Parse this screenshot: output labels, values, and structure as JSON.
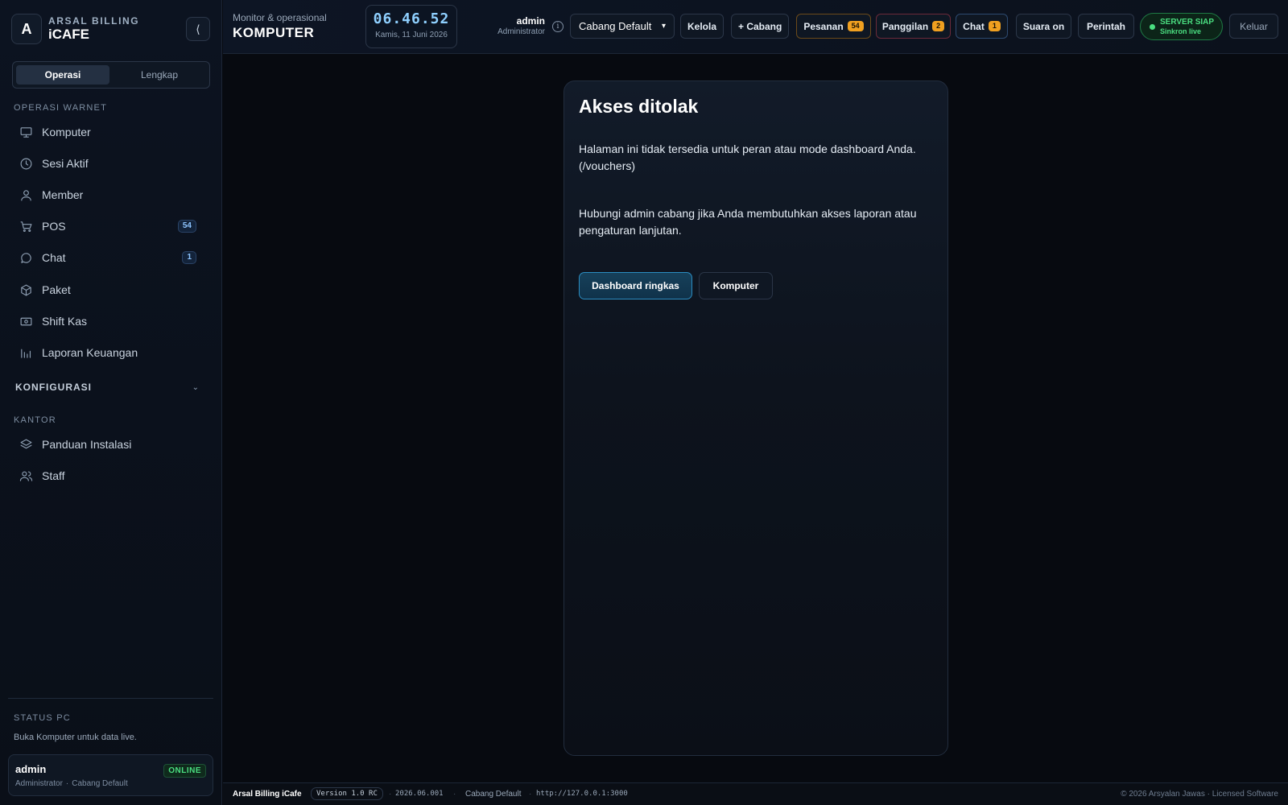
{
  "brand": {
    "logo_letter": "A",
    "top": "ARSAL BILLING",
    "main": "iCAFE",
    "collapse_glyph": "⟨"
  },
  "mode": {
    "options": [
      "Operasi",
      "Lengkap"
    ],
    "active": "Operasi"
  },
  "sidebar": {
    "section_operasi": "OPERASI WARNET",
    "items": [
      {
        "label": "Komputer",
        "icon": "monitor-icon"
      },
      {
        "label": "Sesi Aktif",
        "icon": "clock-icon"
      },
      {
        "label": "Member",
        "icon": "user-icon"
      },
      {
        "label": "POS",
        "icon": "cart-icon",
        "count": "54"
      },
      {
        "label": "Chat",
        "icon": "chat-icon",
        "count": "1"
      },
      {
        "label": "Paket",
        "icon": "box-icon"
      },
      {
        "label": "Shift Kas",
        "icon": "cash-icon"
      },
      {
        "label": "Laporan Keuangan",
        "icon": "bar-chart-icon"
      }
    ],
    "section_konfigurasi": "KONFIGURASI",
    "section_kantor": "KANTOR",
    "office_items": [
      {
        "label": "Panduan Instalasi",
        "icon": "layers-icon"
      },
      {
        "label": "Staff",
        "icon": "users-icon"
      }
    ],
    "status_label": "STATUS PC",
    "status_hint": "Buka Komputer untuk data live.",
    "user": {
      "name": "admin",
      "role": "Administrator",
      "branch": "Cabang Default",
      "status": "ONLINE"
    }
  },
  "topbar": {
    "subtitle": "Monitor & operasional",
    "title": "KOMPUTER",
    "clock_time": "06.46.52",
    "clock_date": "Kamis, 11 Juni 2026",
    "user_name": "admin",
    "user_role": "Administrator",
    "info_glyph": "i",
    "branch_value": "Cabang Default",
    "buttons": {
      "kelola": "Kelola",
      "add_branch": "+ Cabang",
      "orders": "Pesanan",
      "orders_count": "54",
      "calls": "Panggilan",
      "calls_count": "2",
      "chat": "Chat",
      "chat_count": "1",
      "sound": "Suara on",
      "command": "Perintah",
      "logout": "Keluar"
    },
    "server": {
      "status": "SERVER SIAP",
      "sync": "Sinkron live"
    }
  },
  "main": {
    "title": "Akses ditolak",
    "message": "Halaman ini tidak tersedia untuk peran atau mode dashboard Anda. (/vouchers)",
    "hint": "Hubungi admin cabang jika Anda membutuhkan akses laporan atau pengaturan lanjutan.",
    "primary_button": "Dashboard ringkas",
    "secondary_button": "Komputer"
  },
  "footer": {
    "brand": "Arsal Billing iCafe",
    "version": "Version 1.0 RC",
    "build": "2026.06.001",
    "branch": "Cabang Default",
    "url": "http://127.0.0.1:3000",
    "copyright": "© 2026 Arsyalan Jawas · Licensed Software",
    "separator": "·"
  },
  "colors": {
    "accent": "#8fd0ff",
    "success": "#4ade80",
    "warning": "#f0a020",
    "background": "#070a10"
  }
}
